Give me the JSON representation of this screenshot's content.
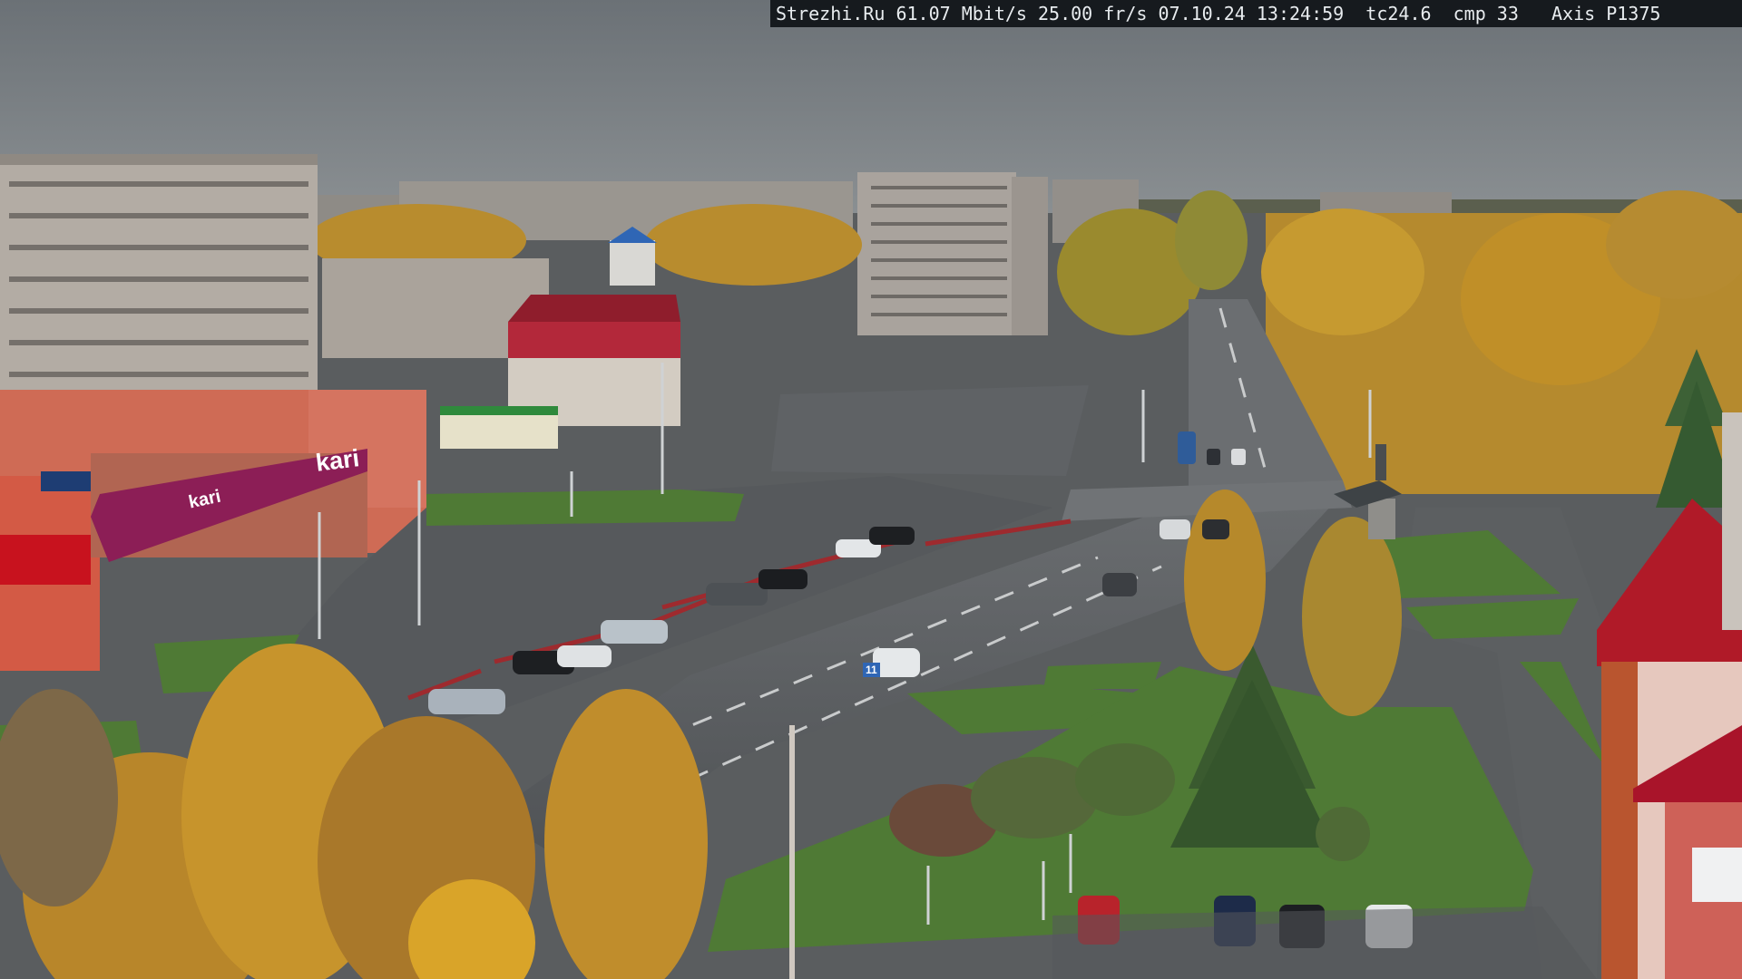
{
  "overlay": {
    "site": "Strezhi.Ru",
    "bitrate": "61.07 Mbit/s",
    "fps": "25.00 fr/s",
    "date": "07.10.24",
    "time": "13:24:59",
    "tc": "tc24.6",
    "cmp": "cmp 33",
    "camera": "Axis P1375"
  },
  "signs": {
    "store_main": "kari",
    "store_front": "kari",
    "route_sign": "11"
  },
  "colors": {
    "sky": "#73797e",
    "asphalt": "#55585b",
    "grass": "#4f7a35",
    "autumn_foliage": "#c99a2c",
    "store_band": "#8c1e56",
    "brick": "#cf6b55",
    "roof_red": "#b01a28"
  }
}
